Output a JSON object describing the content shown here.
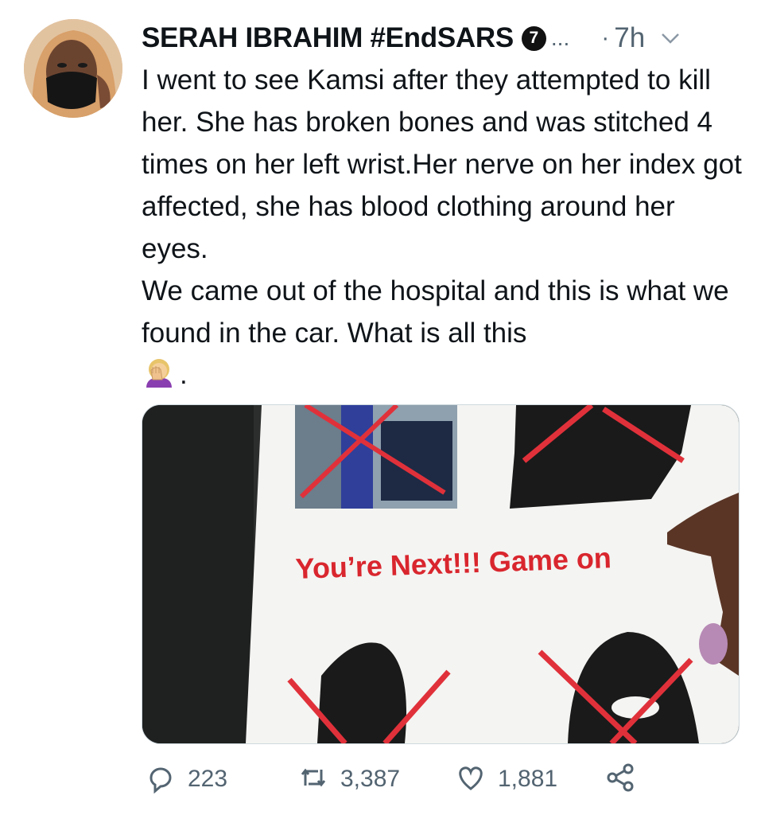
{
  "tweet": {
    "author_name": "SERAH IBRAHIM #EndSARS",
    "author_badge": "7",
    "name_ellipsis": "...",
    "separator": "·",
    "time": "7h",
    "text": "I went to see Kamsi after they attempted to kill her. She has broken bones and was stitched 4 times on her left wrist.Her nerve on her index got affected, she has blood clothing around her eyes.\nWe came out of the hospital and this is what we found in the car. What is all this",
    "text_end": ".",
    "emoji": "facepalm-emoji"
  },
  "media": {
    "poster_text": "You’re Next!!! Game on"
  },
  "actions": {
    "replies": "223",
    "retweets": "3,387",
    "likes": "1,881"
  },
  "colors": {
    "text": "#0f1419",
    "secondary": "#536471",
    "poster_red": "#d9262e"
  }
}
